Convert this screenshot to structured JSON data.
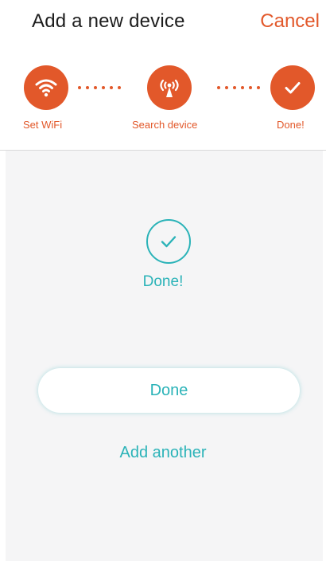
{
  "header": {
    "title": "Add a new device",
    "cancel_label": "Cancel"
  },
  "steps": [
    {
      "label": "Set WiFi",
      "icon": "wifi-icon",
      "state": "complete"
    },
    {
      "label": "Search device",
      "icon": "broadcast-antenna-icon",
      "state": "complete"
    },
    {
      "label": "Done!",
      "icon": "check-icon",
      "state": "complete"
    }
  ],
  "result": {
    "icon": "check-circle-icon",
    "status_text": "Done!"
  },
  "actions": {
    "done_label": "Done",
    "add_another_label": "Add another"
  },
  "colors": {
    "accent": "#e2582a",
    "success": "#2bb3b8",
    "background": "#f5f5f6"
  }
}
